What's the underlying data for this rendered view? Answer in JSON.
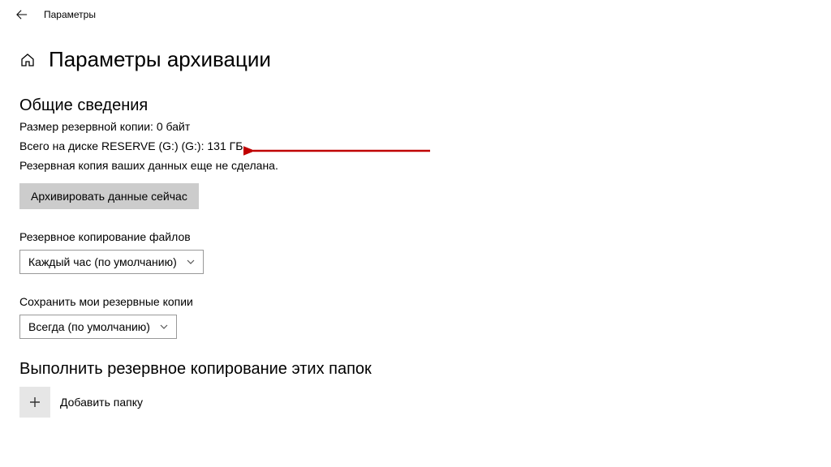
{
  "header": {
    "app_title": "Параметры"
  },
  "page": {
    "title": "Параметры архивации"
  },
  "overview": {
    "heading": "Общие сведения",
    "backup_size": "Размер резервной копии: 0 байт",
    "disk_total": "Всего на диске RESERVE (G:) (G:): 131 ГБ",
    "status": "Резервная копия ваших данных еще не сделана.",
    "backup_now_button": "Архивировать данные сейчас"
  },
  "schedule": {
    "label": "Резервное копирование файлов",
    "selected": "Каждый час (по умолчанию)"
  },
  "retention": {
    "label": "Сохранить мои резервные копии",
    "selected": "Всегда (по умолчанию)"
  },
  "folders": {
    "heading": "Выполнить резервное копирование этих папок",
    "add_label": "Добавить папку"
  }
}
